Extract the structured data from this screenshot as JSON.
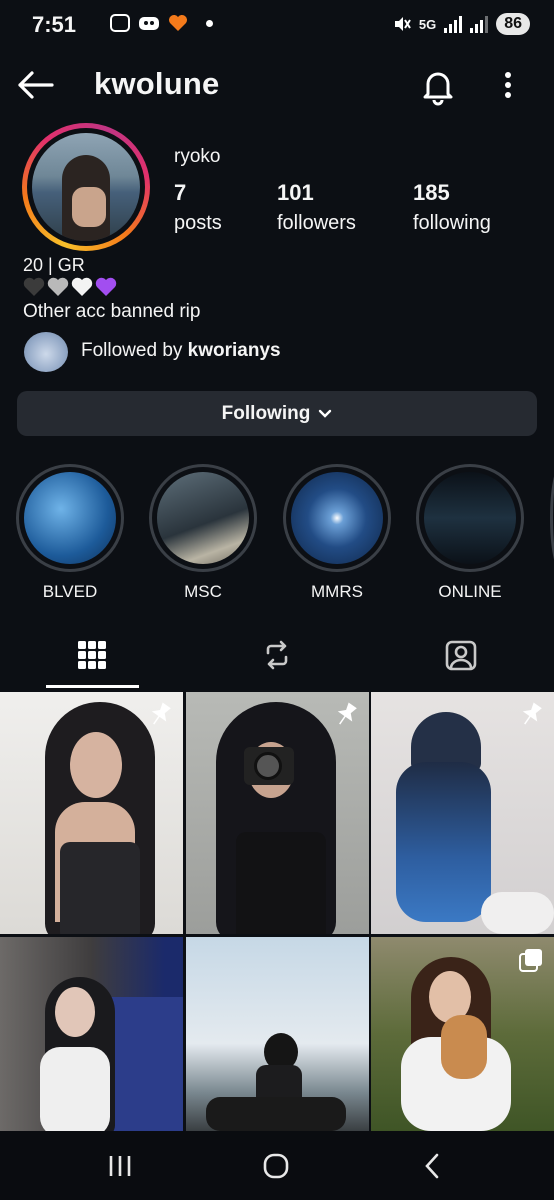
{
  "status_bar": {
    "time": "7:51",
    "network": "5G",
    "battery": "86"
  },
  "header": {
    "username": "kwolune"
  },
  "profile": {
    "display_name": "ryoko",
    "stats": [
      {
        "num": "7",
        "label": "posts"
      },
      {
        "num": "101",
        "label": "followers"
      },
      {
        "num": "185",
        "label": "following"
      }
    ],
    "bio_line1": "20 | GR",
    "bio_hearts": [
      "black-heart",
      "grey-heart",
      "white-heart",
      "purple-heart"
    ],
    "bio_line3": "Other acc banned rip",
    "followed_by_prefix": "Followed by",
    "followed_by_user": "kworianys"
  },
  "follow_button": {
    "label": "Following"
  },
  "highlights": [
    {
      "label": "BLVED"
    },
    {
      "label": "MSC"
    },
    {
      "label": "MMRS"
    },
    {
      "label": "ONLINE"
    }
  ],
  "tabs": [
    "grid-icon",
    "reposts-icon",
    "tagged-icon"
  ],
  "posts": [
    {
      "pinned": true,
      "type": "image"
    },
    {
      "pinned": true,
      "type": "image"
    },
    {
      "pinned": true,
      "type": "image"
    },
    {
      "pinned": false,
      "type": "image"
    },
    {
      "pinned": false,
      "type": "image"
    },
    {
      "pinned": false,
      "type": "carousel"
    }
  ],
  "colors": {
    "background": "#0c0f14",
    "button": "#262a31",
    "ring_start": "#f8c02a",
    "ring_end": "#c13584"
  }
}
